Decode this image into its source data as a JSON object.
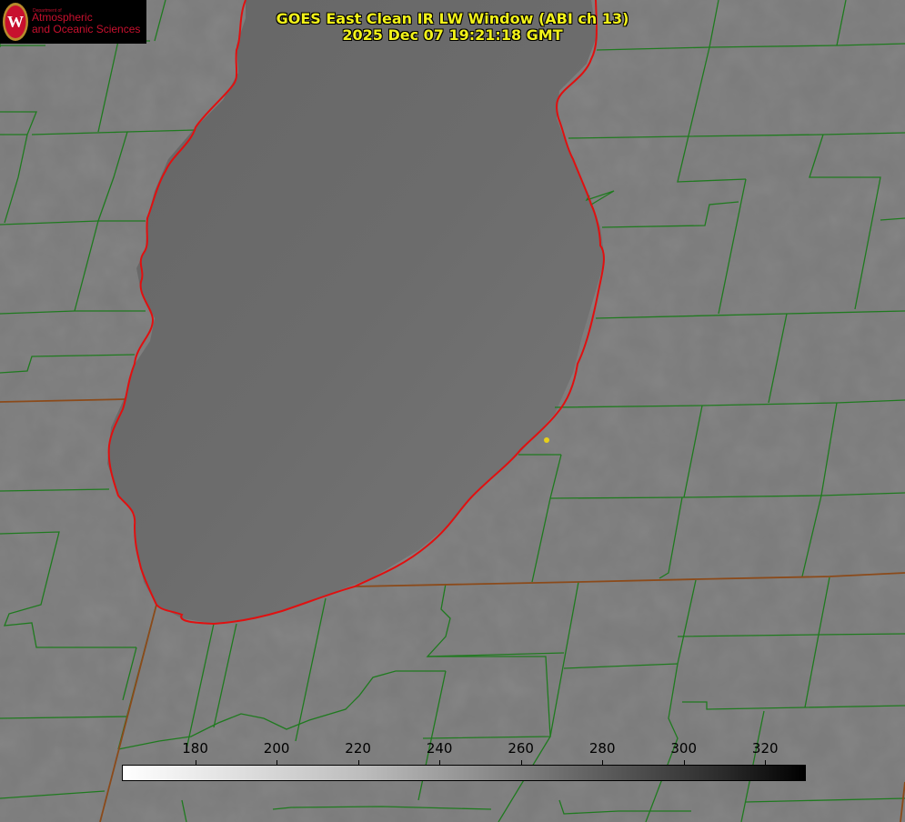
{
  "header": {
    "title_line1": "GOES East Clean IR LW Window (ABI ch 13)",
    "title_line2": "2025 Dec 07 19:21:18 GMT"
  },
  "logo": {
    "dept": "Department of",
    "line1": "Atmospheric",
    "line2": "and Oceanic Sciences",
    "seal_letter": "W"
  },
  "colorbar": {
    "ticks": [
      "180",
      "200",
      "220",
      "240",
      "260",
      "280",
      "300",
      "320"
    ],
    "min_value": 162,
    "max_value": 330
  },
  "colors": {
    "background_gray": "#7b7b7b",
    "lake_gray": "#6a6a6a",
    "county_lines": "#1f7a1f",
    "state_lines": "#8b4a1a",
    "coastline": "#e01010",
    "title_text": "#f2f21a",
    "marker": "#e8d018"
  }
}
